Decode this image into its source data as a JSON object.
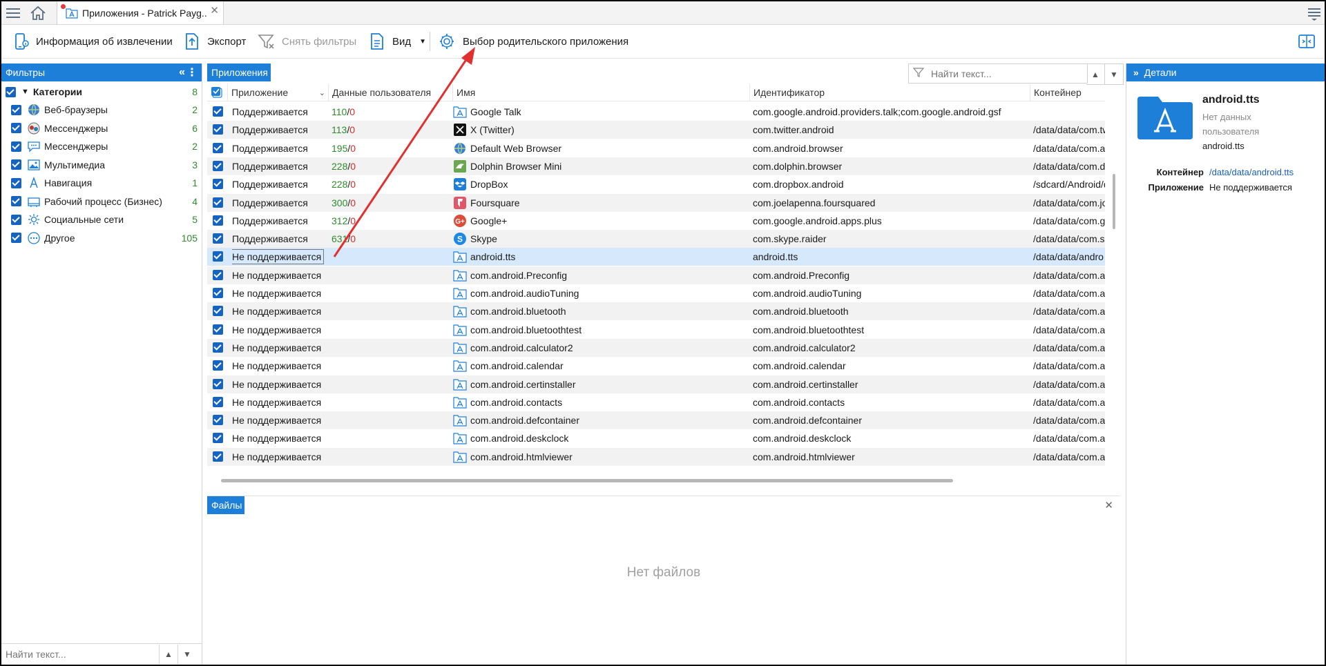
{
  "tab": {
    "title": "Приложения - Patrick Payg..."
  },
  "toolbar": {
    "extraction_info": "Информация об извлечении",
    "export": "Экспорт",
    "clear_filters": "Снять фильтры",
    "view": "Вид",
    "parent_app": "Выбор родительского приложения"
  },
  "filters": {
    "title": "Фильтры",
    "categories_label": "Категории",
    "categories_count": "8",
    "items": [
      {
        "label": "Веб-браузеры",
        "count": "2",
        "icon": "globe-icon"
      },
      {
        "label": "Мессенджеры",
        "count": "6",
        "icon": "messenger-icon"
      },
      {
        "label": "Мессенджеры",
        "count": "2",
        "icon": "chat-bubble-icon"
      },
      {
        "label": "Мультимедиа",
        "count": "3",
        "icon": "image-icon"
      },
      {
        "label": "Навигация",
        "count": "1",
        "icon": "navigation-icon"
      },
      {
        "label": "Рабочий процесс (Бизнес)",
        "count": "4",
        "icon": "briefcase-icon"
      },
      {
        "label": "Социальные сети",
        "count": "5",
        "icon": "social-icon"
      },
      {
        "label": "Другое",
        "count": "105",
        "icon": "more-icon"
      }
    ],
    "search_placeholder": "Найти текст..."
  },
  "apps": {
    "title": "Приложения",
    "search_placeholder": "Найти текст...",
    "columns": [
      "Приложение",
      "Данные пользователя",
      "Имя",
      "Идентификатор",
      "Контейнер"
    ],
    "rows": [
      {
        "status": "Поддерживается",
        "ud_a": "110",
        "ud_b": "0",
        "name": "Google Talk",
        "id": "com.google.android.providers.talk;com.google.android.gsf",
        "container": "",
        "icon": "app-store-icon"
      },
      {
        "status": "Поддерживается",
        "ud_a": "113",
        "ud_b": "0",
        "name": "X (Twitter)",
        "id": "com.twitter.android",
        "container": "/data/data/com.tw",
        "icon": "x-twitter-icon"
      },
      {
        "status": "Поддерживается",
        "ud_a": "195",
        "ud_b": "0",
        "name": "Default Web Browser",
        "id": "com.android.browser",
        "container": "/data/data/com.a",
        "icon": "globe-icon"
      },
      {
        "status": "Поддерживается",
        "ud_a": "228",
        "ud_b": "0",
        "name": "Dolphin Browser Mini",
        "id": "com.dolphin.browser",
        "container": "/data/data/com.d",
        "icon": "dolphin-icon"
      },
      {
        "status": "Поддерживается",
        "ud_a": "228",
        "ud_b": "0",
        "name": "DropBox",
        "id": "com.dropbox.android",
        "container": "/sdcard/Android/d",
        "icon": "dropbox-icon"
      },
      {
        "status": "Поддерживается",
        "ud_a": "300",
        "ud_b": "0",
        "name": "Foursquare",
        "id": "com.joelapenna.foursquared",
        "container": "/data/data/com.jo",
        "icon": "foursquare-icon"
      },
      {
        "status": "Поддерживается",
        "ud_a": "312",
        "ud_b": "0",
        "name": "Google+",
        "id": "com.google.android.apps.plus",
        "container": "/data/data/com.g",
        "icon": "google-plus-icon"
      },
      {
        "status": "Поддерживается",
        "ud_a": "631",
        "ud_b": "0",
        "name": "Skype",
        "id": "com.skype.raider",
        "container": "/data/data/com.s",
        "icon": "skype-icon"
      },
      {
        "status": "Не поддерживается",
        "ud_a": "",
        "ud_b": "",
        "name": "android.tts",
        "id": "android.tts",
        "container": "/data/data/andro",
        "icon": "app-store-icon"
      },
      {
        "status": "Не поддерживается",
        "ud_a": "",
        "ud_b": "",
        "name": "com.android.Preconfig",
        "id": "com.android.Preconfig",
        "container": "/data/data/com.a",
        "icon": "app-store-icon"
      },
      {
        "status": "Не поддерживается",
        "ud_a": "",
        "ud_b": "",
        "name": "com.android.audioTuning",
        "id": "com.android.audioTuning",
        "container": "/data/data/com.a",
        "icon": "app-store-icon"
      },
      {
        "status": "Не поддерживается",
        "ud_a": "",
        "ud_b": "",
        "name": "com.android.bluetooth",
        "id": "com.android.bluetooth",
        "container": "/data/data/com.a",
        "icon": "app-store-icon"
      },
      {
        "status": "Не поддерживается",
        "ud_a": "",
        "ud_b": "",
        "name": "com.android.bluetoothtest",
        "id": "com.android.bluetoothtest",
        "container": "/data/data/com.a",
        "icon": "app-store-icon"
      },
      {
        "status": "Не поддерживается",
        "ud_a": "",
        "ud_b": "",
        "name": "com.android.calculator2",
        "id": "com.android.calculator2",
        "container": "/data/data/com.a",
        "icon": "app-store-icon"
      },
      {
        "status": "Не поддерживается",
        "ud_a": "",
        "ud_b": "",
        "name": "com.android.calendar",
        "id": "com.android.calendar",
        "container": "/data/data/com.a",
        "icon": "app-store-icon"
      },
      {
        "status": "Не поддерживается",
        "ud_a": "",
        "ud_b": "",
        "name": "com.android.certinstaller",
        "id": "com.android.certinstaller",
        "container": "/data/data/com.a",
        "icon": "app-store-icon"
      },
      {
        "status": "Не поддерживается",
        "ud_a": "",
        "ud_b": "",
        "name": "com.android.contacts",
        "id": "com.android.contacts",
        "container": "/data/data/com.a",
        "icon": "app-store-icon"
      },
      {
        "status": "Не поддерживается",
        "ud_a": "",
        "ud_b": "",
        "name": "com.android.defcontainer",
        "id": "com.android.defcontainer",
        "container": "/data/data/com.a",
        "icon": "app-store-icon"
      },
      {
        "status": "Не поддерживается",
        "ud_a": "",
        "ud_b": "",
        "name": "com.android.deskclock",
        "id": "com.android.deskclock",
        "container": "/data/data/com.a",
        "icon": "app-store-icon"
      },
      {
        "status": "Не поддерживается",
        "ud_a": "",
        "ud_b": "",
        "name": "com.android.htmlviewer",
        "id": "com.android.htmlviewer",
        "container": "/data/data/com.a",
        "icon": "app-store-icon"
      }
    ]
  },
  "files": {
    "title": "Файлы",
    "empty": "Нет файлов"
  },
  "details": {
    "title": "Детали",
    "app_name": "android.tts",
    "no_data_line1": "Нет данных",
    "no_data_line2": "пользователя",
    "sub_name": "android.tts",
    "container_label": "Контейнер",
    "container_value": "/data/data/android.tts",
    "app_label": "Приложение",
    "app_value": "Не поддерживается"
  },
  "colors": {
    "accent": "#1e7fd8",
    "checkbox": "#1565c0",
    "green": "#2e8b2e",
    "red": "#d52b2b",
    "annotation_arrow": "#e03030"
  }
}
